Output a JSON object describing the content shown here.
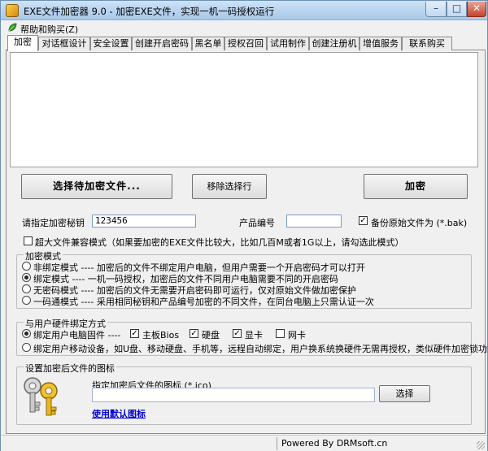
{
  "window": {
    "title": "EXE文件加密器 9.0 - 加密EXE文件，实现一机一码授权运行"
  },
  "menu": {
    "items": [
      "帮助和购买(Z)"
    ]
  },
  "tabs": [
    {
      "label": "加密"
    },
    {
      "label": "对话框设计"
    },
    {
      "label": "安全设置"
    },
    {
      "label": "创建开启密码"
    },
    {
      "label": "黑名单"
    },
    {
      "label": "授权召回"
    },
    {
      "label": "试用制作"
    },
    {
      "label": "创建注册机"
    },
    {
      "label": "增值服务"
    },
    {
      "label": "联系购买"
    }
  ],
  "buttons": {
    "select_file": "选择待加密文件...",
    "remove_selected": "移除选择行",
    "encrypt": "加密",
    "browse": "选择"
  },
  "form": {
    "key_label": "请指定加密秘钥",
    "key_value": "123456",
    "product_label": "产品编号",
    "product_value": "",
    "backup_label": "备份原始文件为 (*.bak)",
    "backup_checked": true,
    "large_file_label": "超大文件兼容模式（如果要加密的EXE文件比较大，比如几百M或者1G以上，请勾选此模式）",
    "large_file_checked": false
  },
  "encrypt_mode": {
    "title": "加密模式",
    "options": [
      {
        "label": "非绑定模式 ---- 加密后的文件不绑定用户电脑，但用户需要一个开启密码才可以打开",
        "selected": false
      },
      {
        "label": "绑定模式 ---- 一机一码授权，加密后的文件不同用户电脑需要不同的开启密码",
        "selected": true
      },
      {
        "label": "无密码模式 ---- 加密后的文件无需要开启密码即可运行，仅对原始文件做加密保护",
        "selected": false
      },
      {
        "label": "一码通模式 ---- 采用相同秘钥和产品编号加密的不同文件，在同台电脑上只需认证一次",
        "selected": false
      }
    ]
  },
  "hardware_binding": {
    "title": "与用户硬件绑定方式",
    "option1_label": "绑定用户电脑固件 ----",
    "option1_selected": true,
    "components": [
      {
        "label": "主板Bios",
        "checked": true
      },
      {
        "label": "硬盘",
        "checked": true
      },
      {
        "label": "显卡",
        "checked": true
      },
      {
        "label": "网卡",
        "checked": false
      }
    ],
    "option2_label": "绑定用户移动设备，如U盘、移动硬盘、手机等，远程自动绑定，用户换系统换硬件无需再授权，类似硬件加密锁功能",
    "option2_selected": false
  },
  "icon_section": {
    "title": "设置加密后文件的图标",
    "label": "指定加密后文件的图标 (*.ico)",
    "path_value": "",
    "default_link": "使用默认图标"
  },
  "status": {
    "text": "Powered By DRMsoft.cn"
  },
  "colors": {
    "titlebar": "#b9d4ef",
    "link": "#0000d0",
    "close": "#c5442d"
  }
}
